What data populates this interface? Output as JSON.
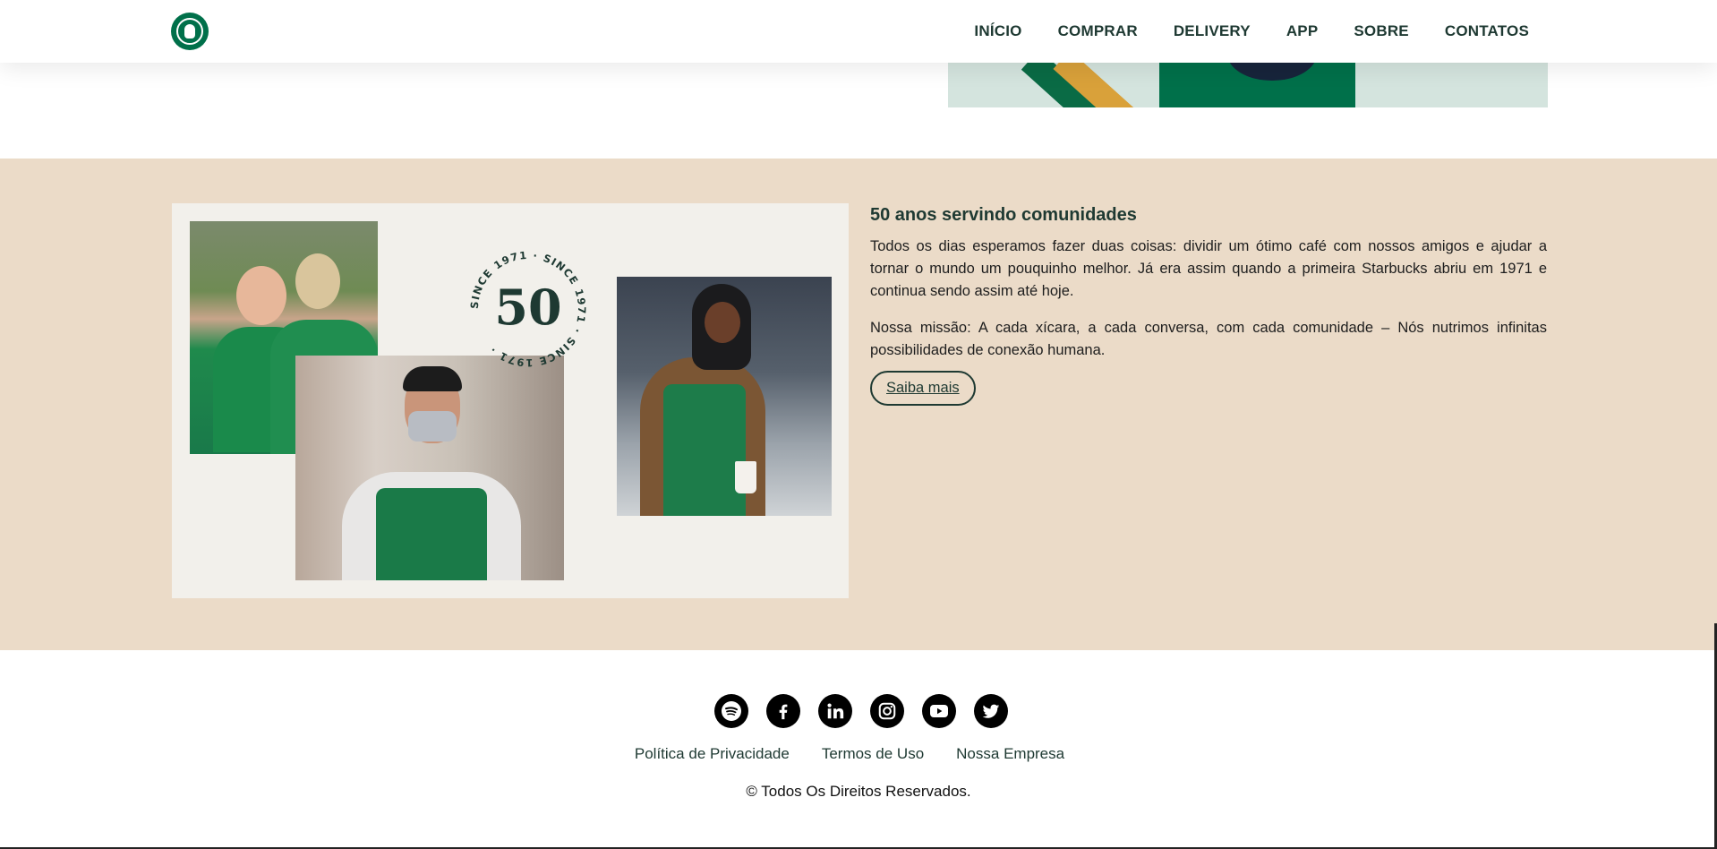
{
  "header": {
    "logo_alt": "Starbucks",
    "nav": [
      {
        "label": "INÍCIO"
      },
      {
        "label": "COMPRAR"
      },
      {
        "label": "DELIVERY"
      },
      {
        "label": "APP"
      },
      {
        "label": "SOBRE"
      },
      {
        "label": "CONTATOS"
      }
    ]
  },
  "section": {
    "emblem": {
      "number": "50",
      "ring_text": "SINCE 1971 · SINCE 1971 · SINCE 1971 · "
    },
    "title": "50 anos servindo comunidades",
    "paragraphs": [
      "Todos os dias esperamos fazer duas coisas: dividir um ótimo café com nossos amigos e ajudar a tornar o mundo um pouquinho melhor. Já era assim quando a primeira Starbucks abriu em 1971 e continua sendo assim até hoje.",
      "Nossa missão: A cada xícara, a cada conversa, com cada comunidade – Nós nutrimos infinitas possibilidades de conexão humana."
    ],
    "button_label": "Saiba mais"
  },
  "footer": {
    "socials": [
      {
        "name": "spotify-icon"
      },
      {
        "name": "facebook-icon"
      },
      {
        "name": "linkedin-icon"
      },
      {
        "name": "instagram-icon"
      },
      {
        "name": "youtube-icon"
      },
      {
        "name": "twitter-icon"
      }
    ],
    "links": [
      {
        "label": "Política de Privacidade"
      },
      {
        "label": "Termos de Uso"
      },
      {
        "label": "Nossa Empresa"
      }
    ],
    "copyright": "© Todos Os Direitos Reservados."
  },
  "colors": {
    "brand_green": "#00704a",
    "dark_green": "#1e3932",
    "section_bg": "#ebdbc8",
    "collage_bg": "#f2f0eb"
  }
}
